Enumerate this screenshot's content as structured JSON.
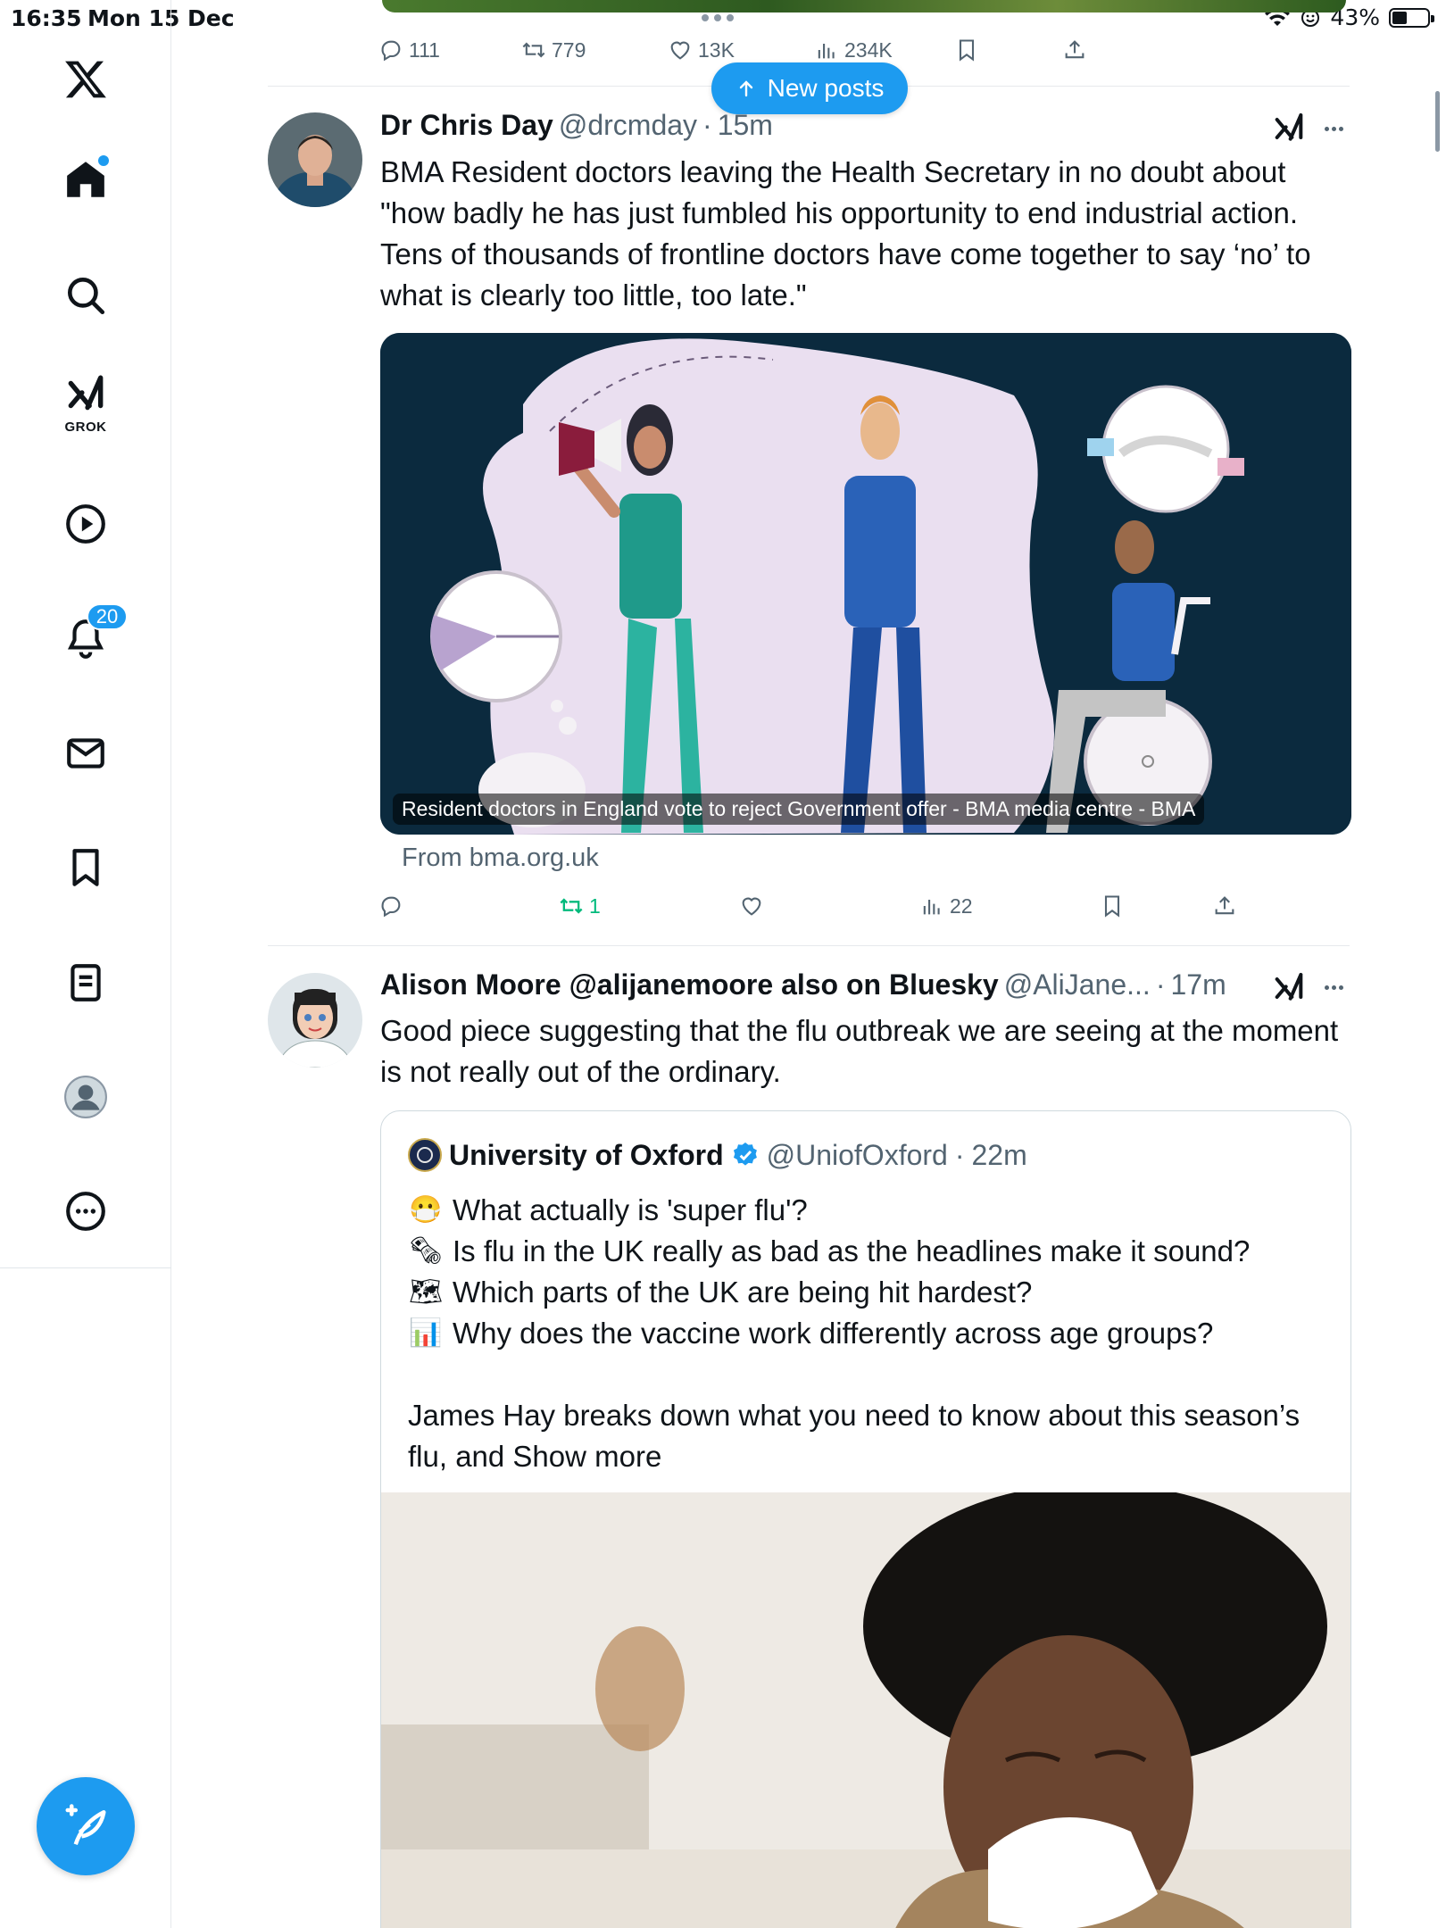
{
  "status": {
    "time": "16:35",
    "date": "Mon 15 Dec",
    "battery": "43%",
    "battery_level": 0.43
  },
  "sidebar": {
    "grok_label": "GROK",
    "notifications_badge": "20"
  },
  "top_post": {
    "replies": "111",
    "reposts": "779",
    "likes": "13K",
    "views": "234K"
  },
  "new_posts_label": "New posts",
  "post1": {
    "name": "Dr Chris Day",
    "handle": "@drcmday",
    "dot": "·",
    "time": "15m",
    "text": "BMA Resident doctors leaving the Health Secretary in no doubt about \"how badly he has just fumbled his opportunity to end industrial action. Tens of thousands of frontline doctors have come together to say ‘no’ to what is clearly too little, too late.\"",
    "card_caption": "Resident doctors in England vote to reject Government offer - BMA media centre - BMA",
    "from": "From bma.org.uk",
    "reposts": "1",
    "views": "22"
  },
  "post2": {
    "name": "Alison Moore @alijanemoore also on Bluesky",
    "handle": "@AliJane...",
    "dot": "·",
    "time": "17m",
    "text": "Good piece suggesting that the flu outbreak we are seeing at the moment is not really out of the ordinary.",
    "quote": {
      "name": "University of Oxford",
      "handle": "@UniofOxford",
      "dot": "·",
      "time": "22m",
      "lines": [
        {
          "emoji": "😷",
          "text": "What actually is 'super flu'?"
        },
        {
          "emoji": "🗞",
          "text": "Is flu in the UK really as bad as the headlines make it sound?"
        },
        {
          "emoji": "🗺",
          "text": "Which parts of the UK are being hit hardest?"
        },
        {
          "emoji": "📊",
          "text": "Why does the vaccine work differently across age groups?"
        }
      ],
      "para": "James Hay breaks down what you need to know about this season’s flu, and",
      "show_more": "Show more",
      "para2": "season’s flu, and"
    }
  },
  "colors": {
    "accent": "#1d9bf0",
    "green": "#00ba7c",
    "muted": "#536471"
  }
}
